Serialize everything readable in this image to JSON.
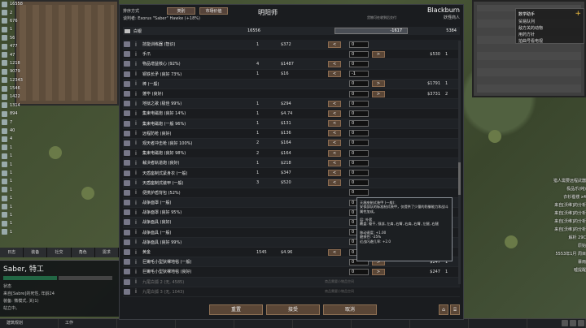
{
  "resources": [
    {
      "icon": "silver-icon",
      "value": "16558"
    },
    {
      "icon": "gold-icon",
      "value": "2"
    },
    {
      "icon": "steel-icon",
      "value": "676"
    },
    {
      "icon": "wood-icon",
      "value": "1"
    },
    {
      "icon": "component-icon",
      "value": "56"
    },
    {
      "icon": "cloth-icon",
      "value": "477"
    },
    {
      "icon": "meal-icon",
      "value": "47"
    },
    {
      "icon": "plasteel-icon",
      "value": "1218"
    },
    {
      "icon": "rice-icon",
      "value": "9079"
    },
    {
      "icon": "medicine-icon",
      "value": "12343"
    },
    {
      "icon": "corn-icon",
      "value": "1546"
    },
    {
      "icon": "potato-icon",
      "value": "1422"
    },
    {
      "icon": "berry-icon",
      "value": "1314"
    },
    {
      "icon": "leather-icon",
      "value": "894"
    },
    {
      "icon": "stone-icon",
      "value": "7"
    },
    {
      "icon": "herb-icon",
      "value": "40"
    },
    {
      "icon": "egg-icon",
      "value": "4"
    },
    {
      "icon": "milk-icon",
      "value": "1"
    },
    {
      "icon": "jade-icon",
      "value": "1"
    },
    {
      "icon": "uranium-icon",
      "value": "1"
    },
    {
      "icon": "bionic-icon",
      "value": "1"
    },
    {
      "icon": "neutro-icon",
      "value": "1"
    },
    {
      "icon": "chem-icon",
      "value": "1"
    },
    {
      "icon": "textile-icon",
      "value": "1"
    },
    {
      "icon": "dye-icon",
      "value": "1"
    },
    {
      "icon": "wool-icon",
      "value": "1"
    },
    {
      "icon": "gem-icon",
      "value": "1"
    },
    {
      "icon": "bone-icon",
      "value": "1"
    }
  ],
  "colonist": {
    "name": "Saber, 特工",
    "line1": "状态",
    "line2": "来自[Sabre]的死性, 年龄24",
    "line3": "装备: 微模式, 关(1)",
    "line4": "站立中。"
  },
  "colonist_tabs": [
    "日志",
    "装备",
    "社交",
    "角色",
    "需求"
  ],
  "bottom_bar": [
    "建筑规划",
    "工作",
    "",
    "",
    "",
    "",
    "",
    "",
    "",
    ""
  ],
  "alerts": {
    "title": "数学助手",
    "items": [
      "贸易队列",
      "敌方关的动物",
      "用药方针",
      "拍曲号看电视"
    ]
  },
  "log": [
    "猎人需要远程武器",
    "极品乐(纯)",
    "衣衫褴褛 x4",
    "来自[沃维]的分析",
    "来自[沃维]的分析",
    "来自[沃维]的分析",
    "来自[沃维]的分析",
    "解析 29C",
    "原始",
    "5553年1月 周目",
    "暴雨",
    "嘘提醒"
  ],
  "dialog": {
    "sort_label": "排序方式",
    "sort_btn_1": "类别",
    "sort_btn_2": "市场价值",
    "negotiator": "谈判者: Exorus \"Saber\" Hawke (+18%)",
    "title": "明阳师",
    "trader_name": "Blackburn",
    "trader_faction": "妖怪商人",
    "caravan_note": "货物可在收到后交付",
    "silver": {
      "label": "白银",
      "colony_qty": "16556",
      "amount": "-1617",
      "trader_qty": "5384"
    },
    "rows": [
      {
        "name": "技能训练器 (智识)",
        "cq": "1",
        "cp": "$372",
        "entry": "0",
        "tp": "",
        "tq": ""
      },
      {
        "name": "手爪",
        "cq": "",
        "cp": "",
        "entry": "0",
        "tp": "$530",
        "tq": "1"
      },
      {
        "name": "物品增益核心 (92%)",
        "cq": "4",
        "cp": "$1487",
        "entry": "0",
        "tp": "",
        "tq": ""
      },
      {
        "name": "铜铁长矛 (良好 73%)",
        "cq": "1",
        "cp": "$16",
        "entry": "-1",
        "tp": "",
        "tq": ""
      },
      {
        "name": "棒 (一般)",
        "cq": "",
        "cp": "",
        "entry": "0",
        "tp": "$1791",
        "tq": "1"
      },
      {
        "name": "蓬毕 (良好)",
        "cq": "",
        "cp": "",
        "entry": "0",
        "tp": "$3731",
        "tq": "2"
      },
      {
        "name": "地狱之歌 (极佳 99%)",
        "cq": "1",
        "cp": "$294",
        "entry": "0",
        "tp": "",
        "tq": ""
      },
      {
        "name": "集束电磁炮 (良好 14%)",
        "cq": "1",
        "cp": "$4.74",
        "entry": "0",
        "tp": "",
        "tq": ""
      },
      {
        "name": "集束电磁炮 (一般 96%)",
        "cq": "1",
        "cp": "$131",
        "entry": "0",
        "tp": "",
        "tq": ""
      },
      {
        "name": "远程防枪 (良好)",
        "cq": "1",
        "cp": "$136",
        "entry": "0",
        "tp": "",
        "tq": ""
      },
      {
        "name": "观天者冲击枪 (良好 100%)",
        "cq": "2",
        "cp": "$164",
        "entry": "0",
        "tp": "",
        "tq": ""
      },
      {
        "name": "集束电磁炮 (良好 98%)",
        "cq": "2",
        "cp": "$164",
        "entry": "0",
        "tp": "",
        "tq": ""
      },
      {
        "name": "裁决者轨道炮 (良好)",
        "cq": "1",
        "cp": "$218",
        "entry": "0",
        "tp": "",
        "tq": ""
      },
      {
        "name": "天盾座制式紧身衣 (一般)",
        "cq": "1",
        "cp": "$347",
        "entry": "0",
        "tp": "",
        "tq": ""
      },
      {
        "name": "天盾座制式装甲 (一般)",
        "cq": "3",
        "cp": "$520",
        "entry": "0",
        "tp": "",
        "tq": ""
      },
      {
        "name": "便携护盾背包 (52%)",
        "cq": "",
        "cp": "",
        "entry": "0",
        "tp": "",
        "tq": ""
      },
      {
        "name": "战争面罩 (一般)",
        "cq": "",
        "cp": "",
        "entry": "0",
        "tp": "",
        "tq": ""
      },
      {
        "name": "战争面罩 (良好 95%)",
        "cq": "",
        "cp": "",
        "entry": "0",
        "tp": "",
        "tq": ""
      },
      {
        "name": "战争面具 (良好)",
        "cq": "",
        "cp": "",
        "entry": "0",
        "tp": "",
        "tq": ""
      },
      {
        "name": "战争面具 (一般)",
        "cq": "",
        "cp": "",
        "entry": "0",
        "tp": "",
        "tq": ""
      },
      {
        "name": "战争面具 (良好 99%)",
        "cq": "",
        "cp": "",
        "entry": "0",
        "tp": "",
        "tq": ""
      },
      {
        "name": "黄金",
        "cq": "1545",
        "cp": "$4.96",
        "entry": "0",
        "tp": "",
        "tq": ""
      },
      {
        "name": "巨獭毛小型狄裸地毯 (一般)",
        "cq": "",
        "cp": "",
        "entry": "0",
        "tp": "$247",
        "tq": "1"
      },
      {
        "name": "巨獭毛小型狄裸地毯 (良好)",
        "cq": "",
        "cp": "",
        "entry": "0",
        "tp": "$247",
        "tq": "1"
      },
      {
        "name": "九尾白狐 2 (无, 4585)",
        "cq": "",
        "cp": "",
        "entry": "",
        "tp": "",
        "tq": "",
        "note": "商品需要小物品空间",
        "dim": true
      },
      {
        "name": "九尾白狐 3 (无, 1043)",
        "cq": "",
        "cp": "",
        "entry": "",
        "tp": "",
        "tq": "",
        "note": "商品需要小物品空间",
        "dim": true
      }
    ],
    "footer": {
      "reset": "重置",
      "accept": "接受",
      "cancel": "取消"
    },
    "tooltip": "天盾座制式装甲 (一般):\n安保部队的标准制式装甲，仅提供了少量的防御能力和战斗属性加成。\n\n层: 外套\n覆盖: 躯干, 颈部, 左肩, 右臂, 右肩, 右臂, 左腿, 右腿\n\n移动速度: +1.00\n磨损性: -25%\n近战闪避几率: +2.0"
  }
}
